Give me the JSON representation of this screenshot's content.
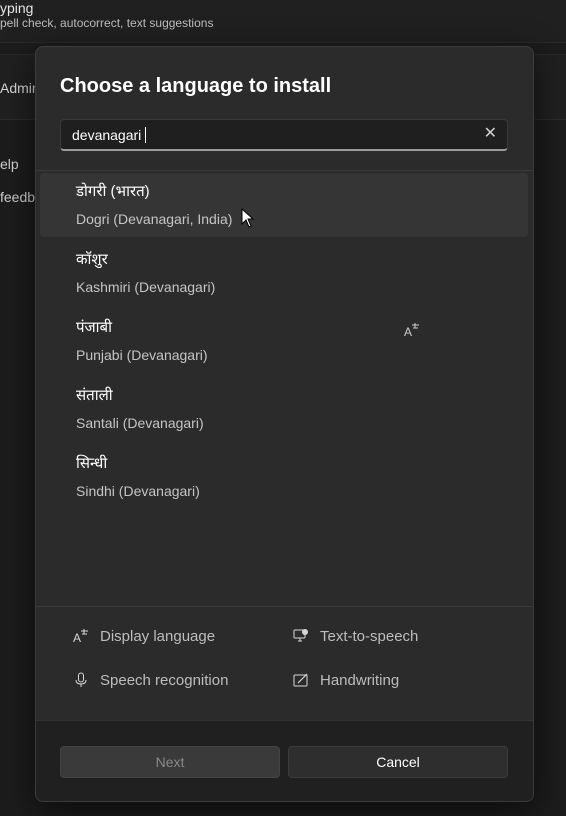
{
  "background": {
    "title": "yping",
    "subtitle": "pell check, autocorrect, text suggestions",
    "admin": "Admin",
    "help": "elp",
    "feedback": "feedba"
  },
  "dialog": {
    "title": "Choose a language to install",
    "search": {
      "value": "devanagari",
      "clear_icon": "close-icon"
    },
    "languages": [
      {
        "native": "डोगरी (भारत)",
        "english": "Dogri (Devanagari, India)",
        "hovered": true
      },
      {
        "native": "कॉशुर",
        "english": "Kashmiri (Devanagari)"
      },
      {
        "native": "पंजाबी",
        "english": "Punjabi (Devanagari)"
      },
      {
        "native": "संताली",
        "english": "Santali (Devanagari)"
      },
      {
        "native": "सिन्धी",
        "english": "Sindhi (Devanagari)"
      }
    ],
    "features": [
      {
        "label": "Display language",
        "icon": "display-language-icon"
      },
      {
        "label": "Text-to-speech",
        "icon": "text-to-speech-icon"
      },
      {
        "label": "Speech recognition",
        "icon": "microphone-icon"
      },
      {
        "label": "Handwriting",
        "icon": "handwriting-icon"
      }
    ],
    "buttons": {
      "next": "Next",
      "cancel": "Cancel"
    }
  }
}
